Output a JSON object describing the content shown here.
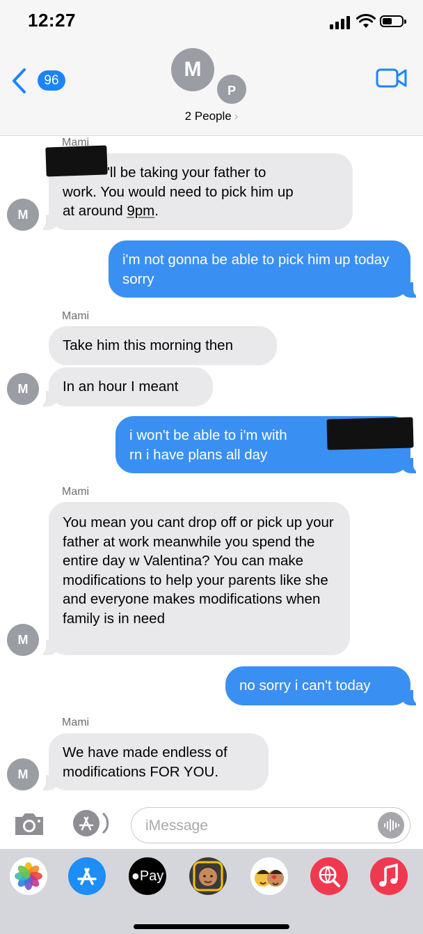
{
  "status_bar": {
    "time": "12:27"
  },
  "nav": {
    "back_count": "96",
    "avatar_primary": "M",
    "avatar_secondary": "P",
    "people_label": "2 People",
    "people_chevron": "›"
  },
  "messages": [
    {
      "sender": "Mami",
      "dir": "in",
      "text_after_redaction": "'ll be taking your father to",
      "text_line2": "work. You would need to pick him up",
      "text_line3_a": "at around ",
      "text_line3_u": "9pm",
      "text_line3_b": ".",
      "avatar": "M"
    },
    {
      "dir": "out",
      "text": "i'm not gonna be able to pick him up today sorry"
    },
    {
      "sender": "Mami",
      "dir": "in",
      "text": "Take him this morning then"
    },
    {
      "dir": "in",
      "text": "In an hour I meant",
      "avatar": "M"
    },
    {
      "dir": "out",
      "text_line1": "i won't be able to i'm with",
      "text_line2": "rn i have plans all day"
    },
    {
      "sender": "Mami",
      "dir": "in",
      "text": "You mean you cant drop off or pick up your father at work meanwhile you spend the entire day w Valentina? You can make modifications to help your parents like she and everyone makes modifications when family is in need",
      "avatar": "M"
    },
    {
      "dir": "out",
      "text": "no sorry i can't today"
    },
    {
      "sender": "Mami",
      "dir": "in",
      "text": "We have made endless of modifications FOR YOU.",
      "avatar": "M"
    }
  ],
  "input": {
    "placeholder": "iMessage"
  },
  "app_strip": {
    "icons": [
      "photos-icon",
      "app-store-icon",
      "apple-pay-icon",
      "memoji-icon",
      "animoji-stickers-icon",
      "web-images-search-icon",
      "music-icon"
    ],
    "apple_pay_label": "Pay"
  },
  "colors": {
    "incoming": "#e9e9eb",
    "outgoing": "#3a8ff3",
    "accent": "#1b84ff"
  }
}
